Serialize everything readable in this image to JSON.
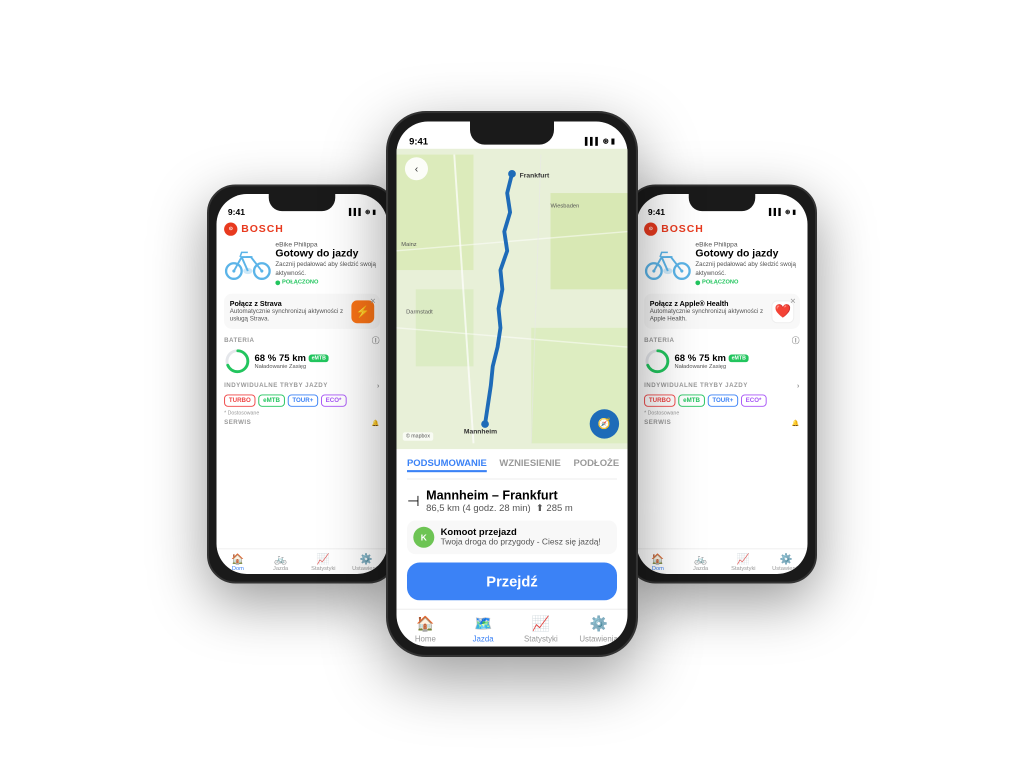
{
  "phones": {
    "left": {
      "time": "9:41",
      "brand": "BOSCH",
      "bike_name": "eBike Philippa",
      "status_title": "Gotowy do jazdy",
      "status_subtitle": "Zacznij pedałować aby śledzić swoją aktywność.",
      "connected": "POŁĄCZONO",
      "promo_title": "Połącz z Strava",
      "promo_subtitle": "Automatycznie synchronizuj aktywności z usługą Strava.",
      "battery_label": "BATERIA",
      "battery_pct": "68 %",
      "battery_km": "75 km",
      "battery_sub": "Naładowanie Zasięg",
      "modes_label": "INDYWIDUALNE TRYBY JAZDY",
      "modes": [
        "TURBO",
        "eMTB",
        "TOUR+",
        "ECO*"
      ],
      "modes_note": "* Dostosowane",
      "serwis": "SERWIS",
      "tabs": [
        "Dom",
        "Jazda",
        "Statystyki",
        "Ustawienia"
      ]
    },
    "right": {
      "time": "9:41",
      "brand": "BOSCH",
      "bike_name": "eBike Philippa",
      "status_title": "Gotowy do jazdy",
      "status_subtitle": "Zacznij pedałować aby śledzić swoją aktywność.",
      "connected": "POŁĄCZONO",
      "promo_title": "Połącz z Apple® Health",
      "promo_subtitle": "Automatycznie synchronizuj aktywności z Apple Health.",
      "battery_label": "BATERIA",
      "battery_pct": "68 %",
      "battery_km": "75 km",
      "battery_sub": "Naładowanie Zasięg",
      "modes_label": "INDYWIDUALNE TRYBY JAZDY",
      "modes": [
        "TURBO",
        "eMTB",
        "TOUR+",
        "ECO*"
      ],
      "modes_note": "* Dostosowane",
      "serwis": "SERWIS",
      "tabs": [
        "Dom",
        "Jazda",
        "Statystyki",
        "Ustawienia"
      ]
    },
    "center": {
      "time": "9:41",
      "tabs": [
        "PODSUMOWANIE",
        "WZNIESIENIE",
        "PODŁOŻE"
      ],
      "route_name": "Mannheim – Frankfurt",
      "route_distance": "86,5 km (4 godz. 28 min)",
      "route_elevation": "285 m",
      "komoot_title": "Komoot przejazd",
      "komoot_subtitle": "Twoja droga do przygody - Ciesz się jazdą!",
      "go_button": "Przejdź",
      "bottom_tabs": [
        "Home",
        "Jazda",
        "Statystyki",
        "Ustawienia"
      ]
    }
  }
}
